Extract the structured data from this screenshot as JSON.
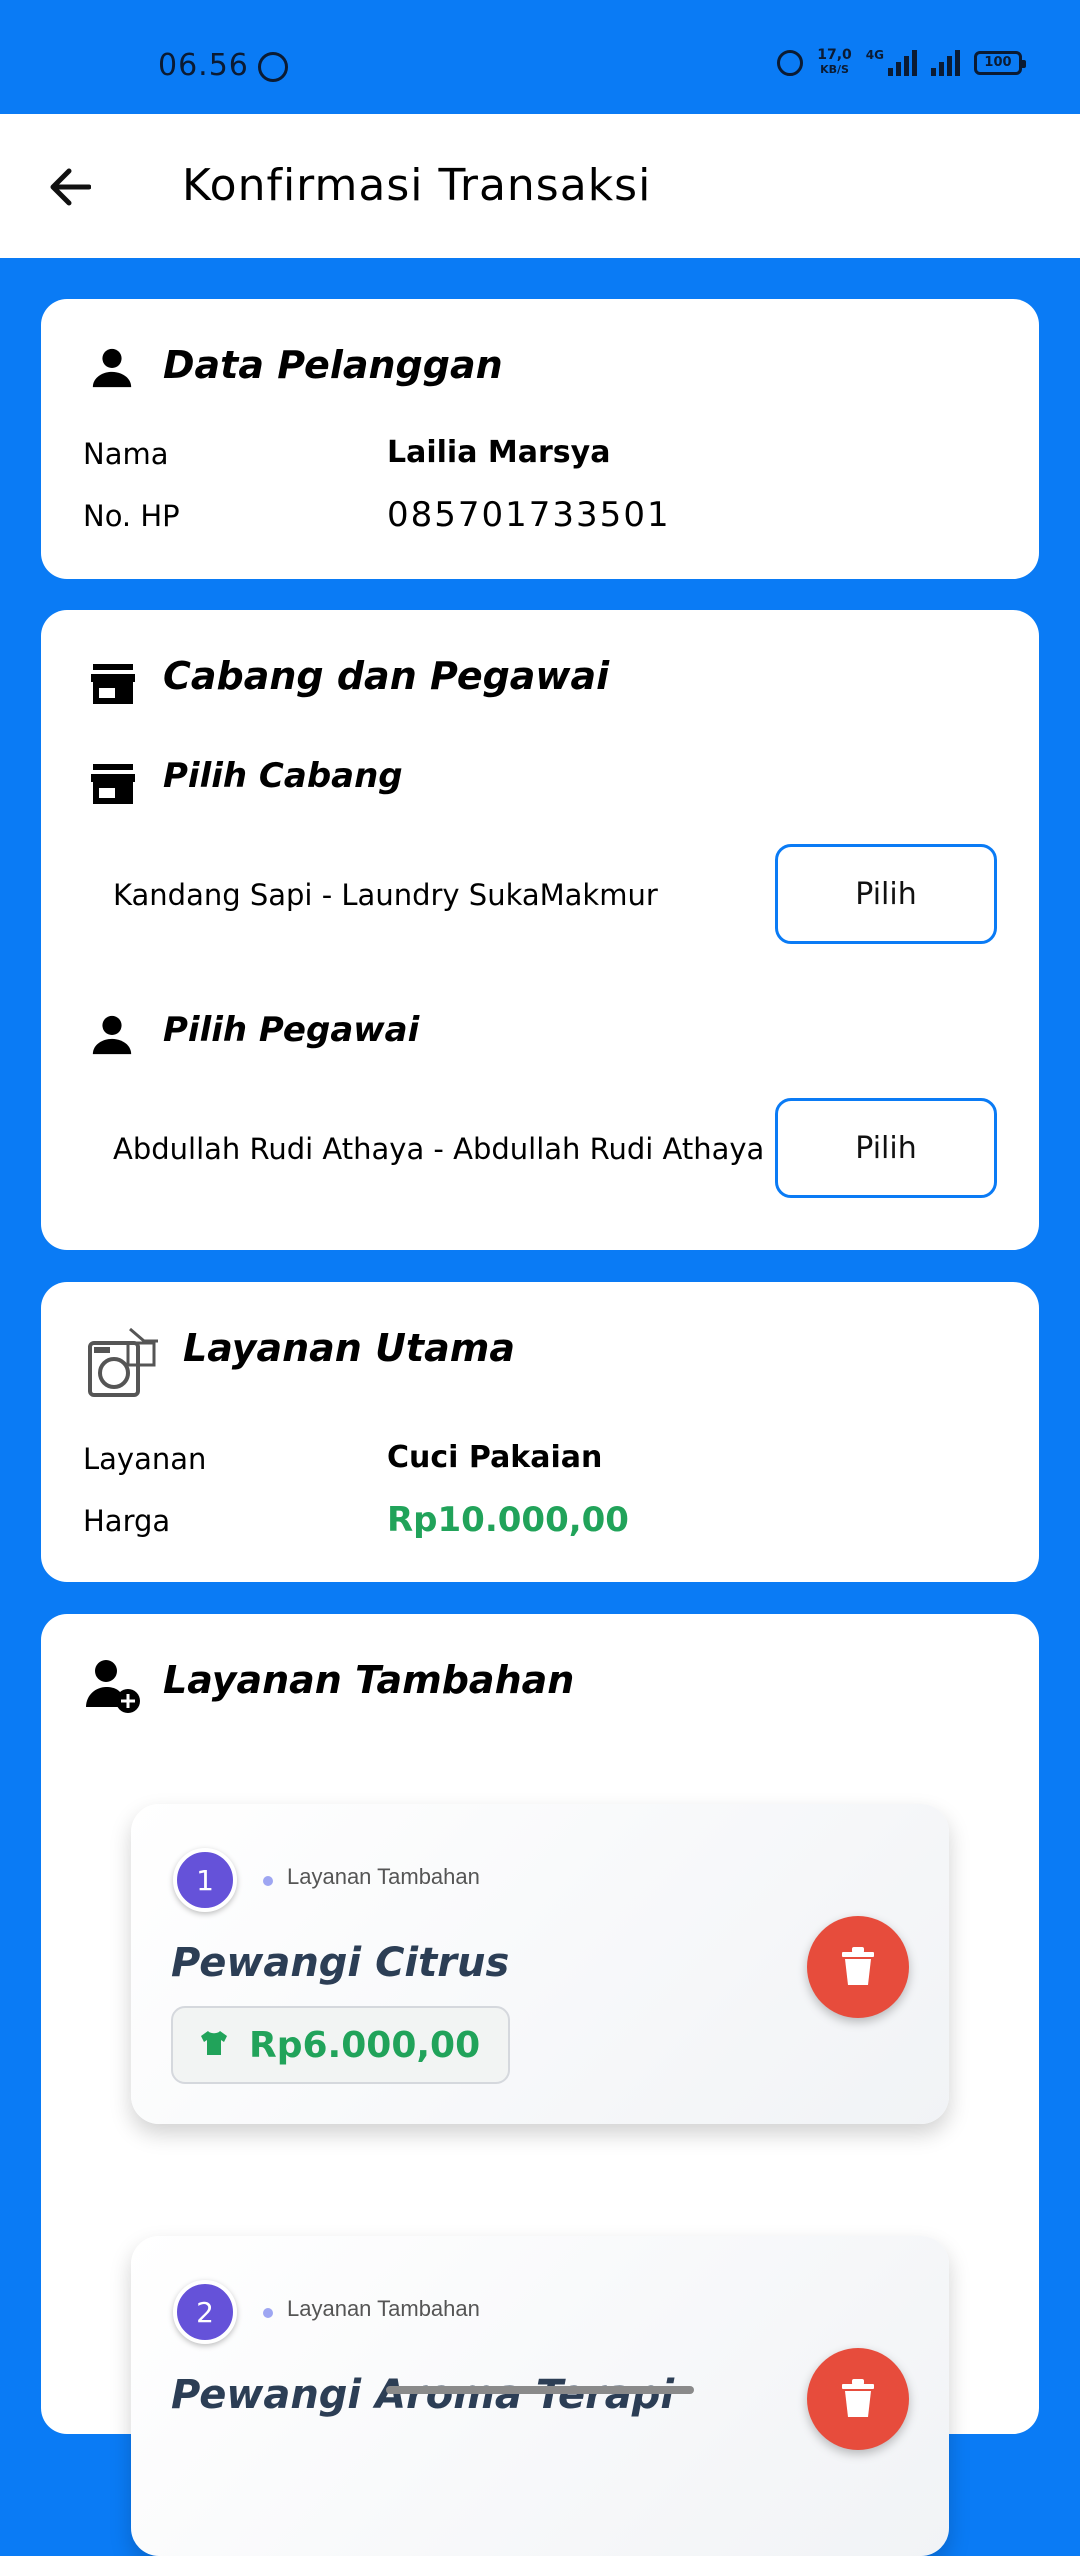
{
  "status_bar": {
    "time": "06.56",
    "speed_value": "17,0",
    "speed_unit": "KB/S",
    "network": "4G",
    "battery": "100"
  },
  "app_bar": {
    "title": "Konfirmasi Transaksi"
  },
  "customer": {
    "section_title": "Data Pelanggan",
    "name_label": "Nama",
    "name_value": "Lailia Marsya",
    "phone_label": "No. HP",
    "phone_value": "085701733501"
  },
  "branch_employee": {
    "section_title": "Cabang dan Pegawai",
    "branch_title": "Pilih Cabang",
    "branch_value": "Kandang Sapi - Laundry SukaMakmur",
    "branch_button": "Pilih",
    "employee_title": "Pilih Pegawai",
    "employee_value": "Abdullah Rudi Athaya - Abdullah Rudi Athaya",
    "employee_button": "Pilih"
  },
  "main_service": {
    "section_title": "Layanan Utama",
    "service_label": "Layanan",
    "service_value": "Cuci Pakaian",
    "price_label": "Harga",
    "price_value": "Rp10.000,00"
  },
  "additional": {
    "section_title": "Layanan Tambahan",
    "items": [
      {
        "number": "1",
        "tag": "Layanan Tambahan",
        "name": "Pewangi Citrus",
        "price": "Rp6.000,00"
      },
      {
        "number": "2",
        "tag": "Layanan Tambahan",
        "name": "Pewangi Aroma Terapi"
      }
    ]
  },
  "colors": {
    "primary": "#0A7BF5",
    "price_green": "#21A35A",
    "badge_purple": "#6552D9",
    "delete_red": "#E74C3C"
  }
}
